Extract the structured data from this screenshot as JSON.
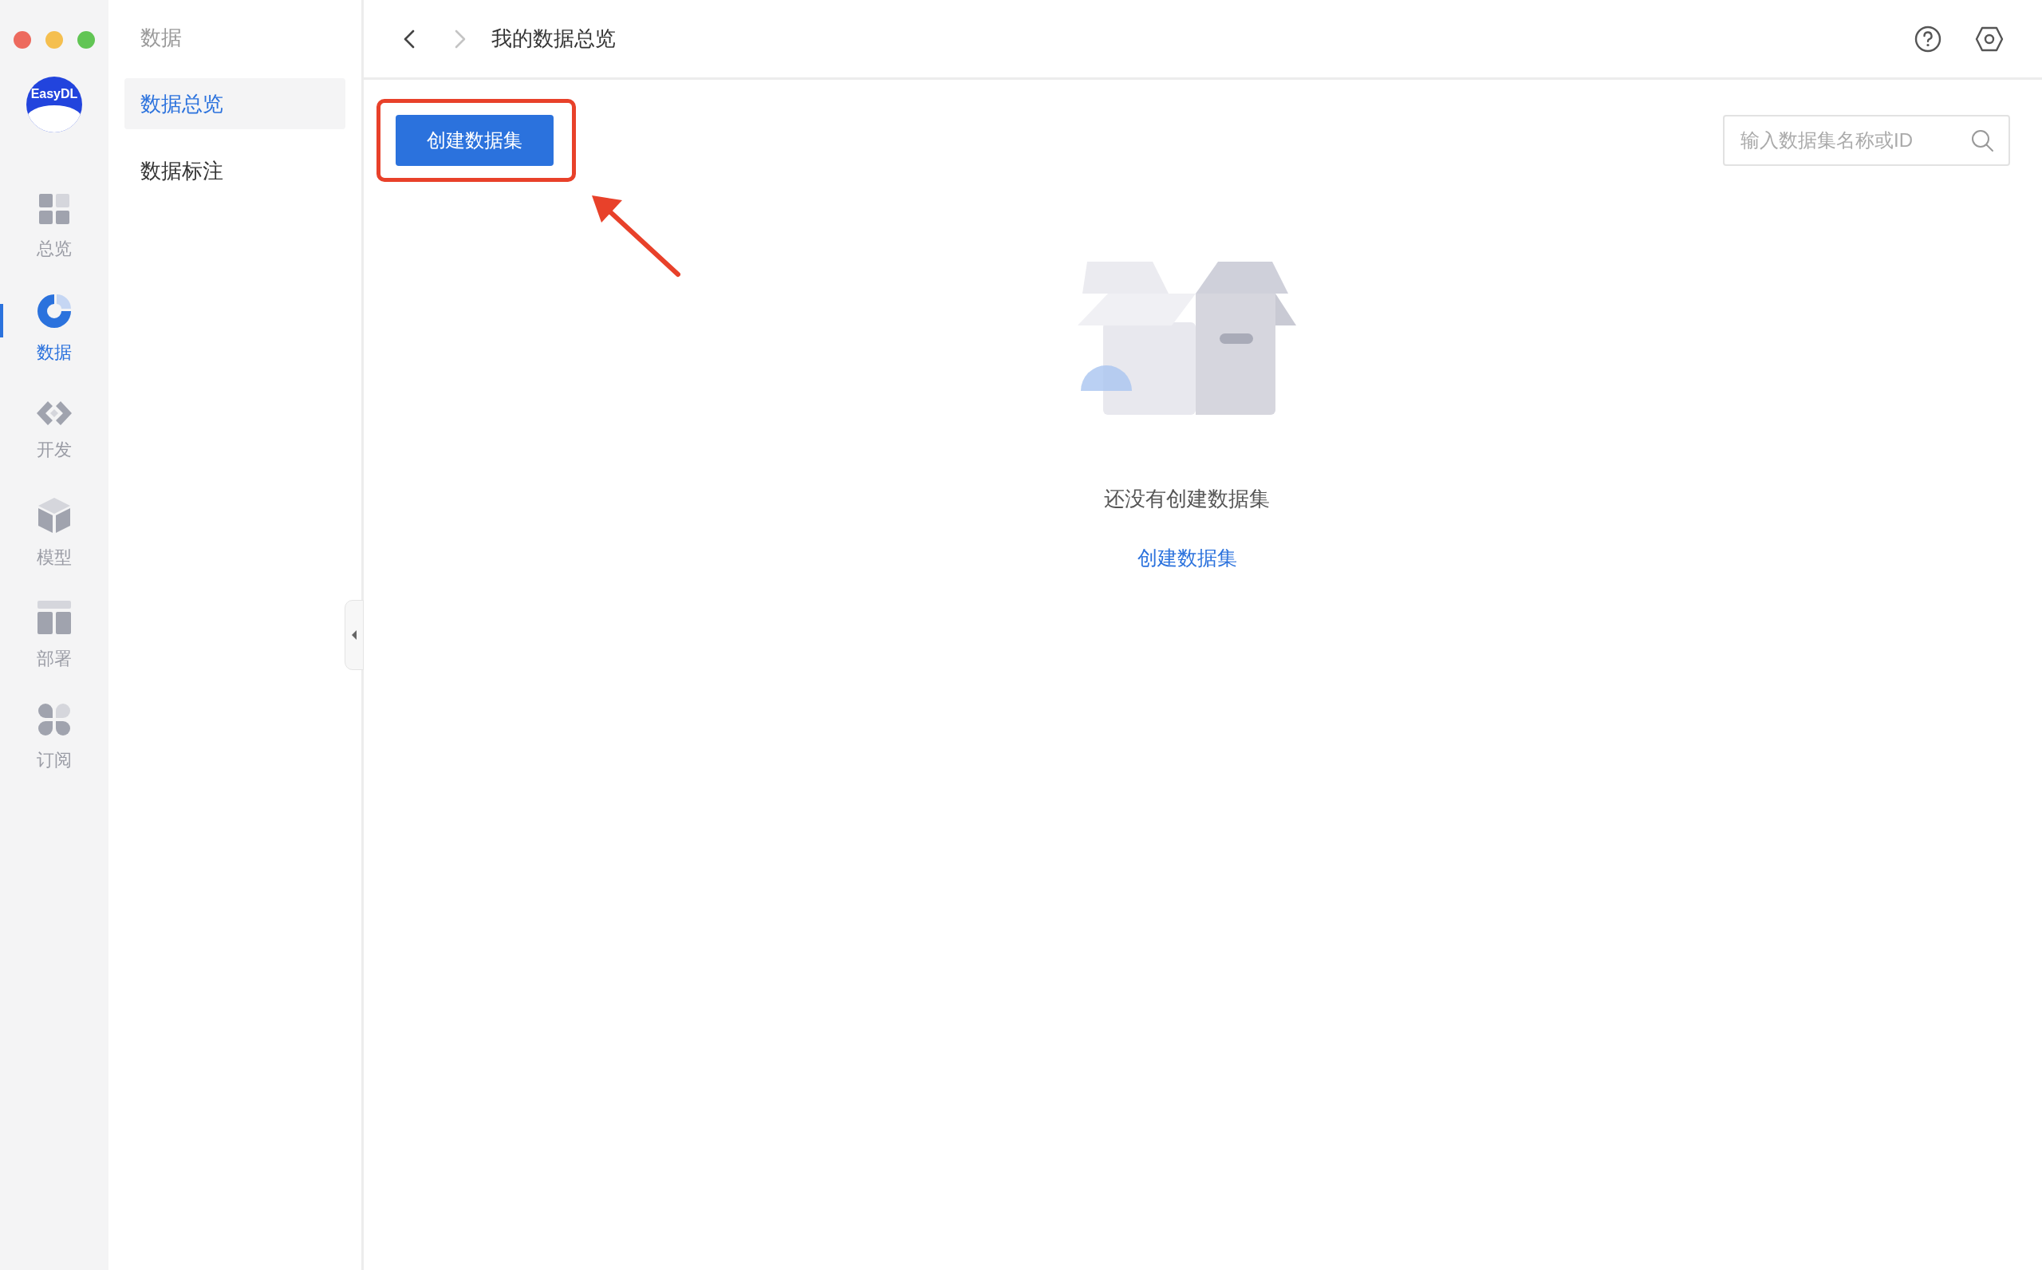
{
  "nav_rail": {
    "logo": "EasyDL",
    "items": [
      {
        "label": "总览",
        "selected": false
      },
      {
        "label": "数据",
        "selected": true
      },
      {
        "label": "开发",
        "selected": false
      },
      {
        "label": "模型",
        "selected": false
      },
      {
        "label": "部署",
        "selected": false
      },
      {
        "label": "订阅",
        "selected": false
      }
    ]
  },
  "sidebar": {
    "title": "数据",
    "items": [
      {
        "label": "数据总览",
        "selected": true
      },
      {
        "label": "数据标注",
        "selected": false
      }
    ]
  },
  "header": {
    "nav": [
      {
        "kind": "back",
        "disabled": false
      },
      {
        "kind": "forward",
        "disabled": true
      }
    ],
    "title": "我的数据总览"
  },
  "toolbar": {
    "create_button": "创建数据集",
    "search": {
      "placeholder": "输入数据集名称或ID"
    }
  },
  "empty_state": {
    "message": "还没有创建数据集",
    "link": "创建数据集"
  }
}
